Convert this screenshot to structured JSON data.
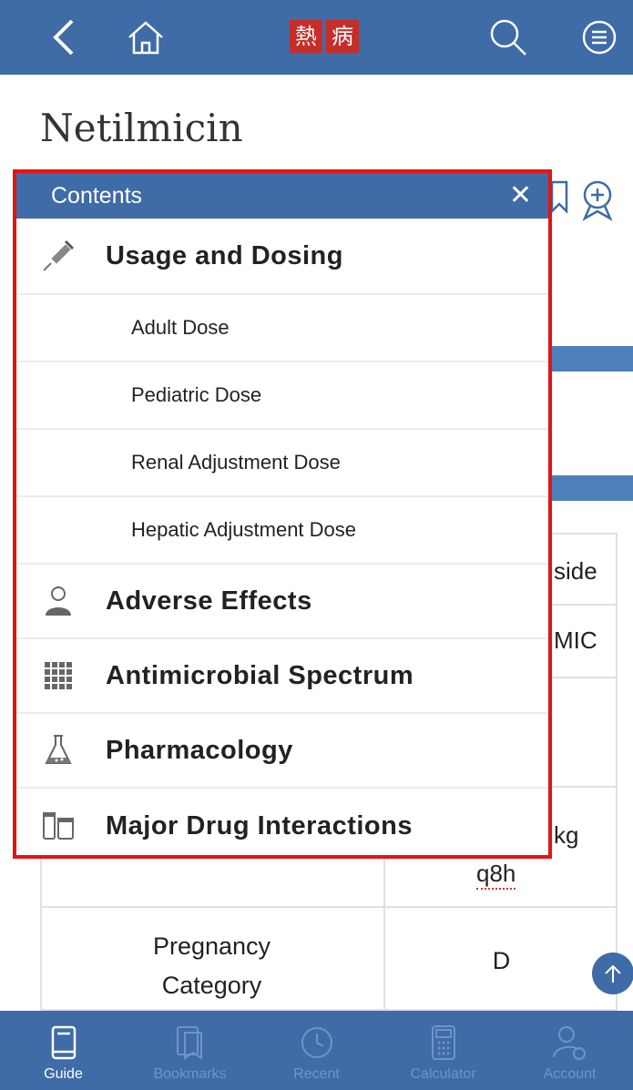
{
  "logo": {
    "chars": [
      "熱",
      "病"
    ]
  },
  "page": {
    "title": "Netilmicin"
  },
  "background": {
    "partial_texts": [
      "side",
      "MIC",
      "kg",
      "q8h"
    ],
    "pregnancy_label_line1": "Pregnancy",
    "pregnancy_label_line2": "Category",
    "pregnancy_value": "D"
  },
  "contents": {
    "title": "Contents",
    "close": "✕",
    "sections": [
      {
        "label": "Usage and Dosing",
        "icon": "syringe-icon"
      },
      {
        "label": "Adult Dose"
      },
      {
        "label": "Pediatric Dose"
      },
      {
        "label": "Renal Adjustment Dose"
      },
      {
        "label": "Hepatic Adjustment Dose"
      },
      {
        "label": "Adverse Effects",
        "icon": "person-icon"
      },
      {
        "label": "Antimicrobial Spectrum",
        "icon": "grid-icon"
      },
      {
        "label": "Pharmacology",
        "icon": "flask-icon"
      },
      {
        "label": "Major Drug Interactions",
        "icon": "pill-bottles-icon"
      }
    ]
  },
  "bottom_nav": [
    {
      "label": "Guide",
      "icon": "book-icon",
      "active": true
    },
    {
      "label": "Bookmarks",
      "icon": "bookmarks-icon",
      "active": false
    },
    {
      "label": "Recent",
      "icon": "clock-icon",
      "active": false
    },
    {
      "label": "Calculator",
      "icon": "calculator-icon",
      "active": false
    },
    {
      "label": "Account",
      "icon": "account-icon",
      "active": false
    }
  ],
  "colors": {
    "primary": "#3f6ba6",
    "highlight": "#e31414",
    "logo_bg": "#c62e2a"
  }
}
